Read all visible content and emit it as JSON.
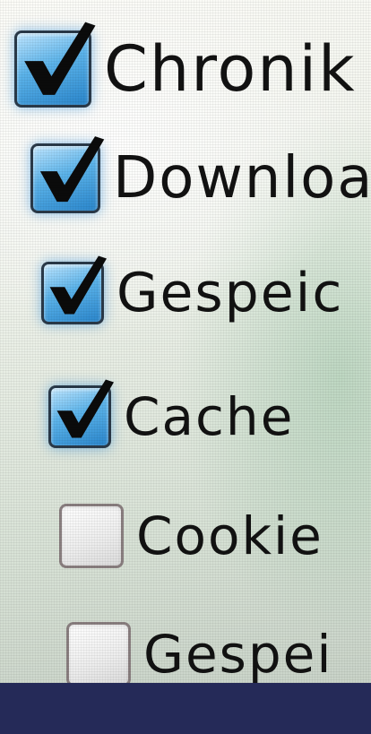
{
  "options": [
    {
      "label": "Chronik",
      "checked": true,
      "icon": "checkmark-icon"
    },
    {
      "label": "Downloa",
      "checked": true,
      "icon": "checkmark-icon"
    },
    {
      "label": "Gespeic",
      "checked": true,
      "icon": "checkmark-icon"
    },
    {
      "label": "Cache",
      "checked": true,
      "icon": "checkmark-icon"
    },
    {
      "label": "Cookie",
      "checked": false
    },
    {
      "label": "Gespei",
      "checked": false
    }
  ],
  "colors": {
    "checkbox_checked": "#3a9ee0",
    "checkbox_border": "#2a3a4a",
    "text": "#121212",
    "footer_bar": "#252a58"
  }
}
